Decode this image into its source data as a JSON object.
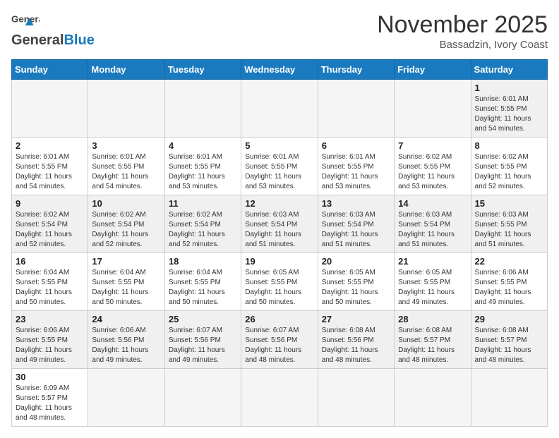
{
  "header": {
    "logo_general": "General",
    "logo_blue": "Blue",
    "month_title": "November 2025",
    "location": "Bassadzin, Ivory Coast"
  },
  "days_of_week": [
    "Sunday",
    "Monday",
    "Tuesday",
    "Wednesday",
    "Thursday",
    "Friday",
    "Saturday"
  ],
  "weeks": [
    [
      {
        "day": "",
        "info": ""
      },
      {
        "day": "",
        "info": ""
      },
      {
        "day": "",
        "info": ""
      },
      {
        "day": "",
        "info": ""
      },
      {
        "day": "",
        "info": ""
      },
      {
        "day": "",
        "info": ""
      },
      {
        "day": "1",
        "info": "Sunrise: 6:01 AM\nSunset: 5:55 PM\nDaylight: 11 hours\nand 54 minutes."
      }
    ],
    [
      {
        "day": "2",
        "info": "Sunrise: 6:01 AM\nSunset: 5:55 PM\nDaylight: 11 hours\nand 54 minutes."
      },
      {
        "day": "3",
        "info": "Sunrise: 6:01 AM\nSunset: 5:55 PM\nDaylight: 11 hours\nand 54 minutes."
      },
      {
        "day": "4",
        "info": "Sunrise: 6:01 AM\nSunset: 5:55 PM\nDaylight: 11 hours\nand 53 minutes."
      },
      {
        "day": "5",
        "info": "Sunrise: 6:01 AM\nSunset: 5:55 PM\nDaylight: 11 hours\nand 53 minutes."
      },
      {
        "day": "6",
        "info": "Sunrise: 6:01 AM\nSunset: 5:55 PM\nDaylight: 11 hours\nand 53 minutes."
      },
      {
        "day": "7",
        "info": "Sunrise: 6:02 AM\nSunset: 5:55 PM\nDaylight: 11 hours\nand 53 minutes."
      },
      {
        "day": "8",
        "info": "Sunrise: 6:02 AM\nSunset: 5:55 PM\nDaylight: 11 hours\nand 52 minutes."
      }
    ],
    [
      {
        "day": "9",
        "info": "Sunrise: 6:02 AM\nSunset: 5:54 PM\nDaylight: 11 hours\nand 52 minutes."
      },
      {
        "day": "10",
        "info": "Sunrise: 6:02 AM\nSunset: 5:54 PM\nDaylight: 11 hours\nand 52 minutes."
      },
      {
        "day": "11",
        "info": "Sunrise: 6:02 AM\nSunset: 5:54 PM\nDaylight: 11 hours\nand 52 minutes."
      },
      {
        "day": "12",
        "info": "Sunrise: 6:03 AM\nSunset: 5:54 PM\nDaylight: 11 hours\nand 51 minutes."
      },
      {
        "day": "13",
        "info": "Sunrise: 6:03 AM\nSunset: 5:54 PM\nDaylight: 11 hours\nand 51 minutes."
      },
      {
        "day": "14",
        "info": "Sunrise: 6:03 AM\nSunset: 5:54 PM\nDaylight: 11 hours\nand 51 minutes."
      },
      {
        "day": "15",
        "info": "Sunrise: 6:03 AM\nSunset: 5:55 PM\nDaylight: 11 hours\nand 51 minutes."
      }
    ],
    [
      {
        "day": "16",
        "info": "Sunrise: 6:04 AM\nSunset: 5:55 PM\nDaylight: 11 hours\nand 50 minutes."
      },
      {
        "day": "17",
        "info": "Sunrise: 6:04 AM\nSunset: 5:55 PM\nDaylight: 11 hours\nand 50 minutes."
      },
      {
        "day": "18",
        "info": "Sunrise: 6:04 AM\nSunset: 5:55 PM\nDaylight: 11 hours\nand 50 minutes."
      },
      {
        "day": "19",
        "info": "Sunrise: 6:05 AM\nSunset: 5:55 PM\nDaylight: 11 hours\nand 50 minutes."
      },
      {
        "day": "20",
        "info": "Sunrise: 6:05 AM\nSunset: 5:55 PM\nDaylight: 11 hours\nand 50 minutes."
      },
      {
        "day": "21",
        "info": "Sunrise: 6:05 AM\nSunset: 5:55 PM\nDaylight: 11 hours\nand 49 minutes."
      },
      {
        "day": "22",
        "info": "Sunrise: 6:06 AM\nSunset: 5:55 PM\nDaylight: 11 hours\nand 49 minutes."
      }
    ],
    [
      {
        "day": "23",
        "info": "Sunrise: 6:06 AM\nSunset: 5:55 PM\nDaylight: 11 hours\nand 49 minutes."
      },
      {
        "day": "24",
        "info": "Sunrise: 6:06 AM\nSunset: 5:56 PM\nDaylight: 11 hours\nand 49 minutes."
      },
      {
        "day": "25",
        "info": "Sunrise: 6:07 AM\nSunset: 5:56 PM\nDaylight: 11 hours\nand 49 minutes."
      },
      {
        "day": "26",
        "info": "Sunrise: 6:07 AM\nSunset: 5:56 PM\nDaylight: 11 hours\nand 48 minutes."
      },
      {
        "day": "27",
        "info": "Sunrise: 6:08 AM\nSunset: 5:56 PM\nDaylight: 11 hours\nand 48 minutes."
      },
      {
        "day": "28",
        "info": "Sunrise: 6:08 AM\nSunset: 5:57 PM\nDaylight: 11 hours\nand 48 minutes."
      },
      {
        "day": "29",
        "info": "Sunrise: 6:08 AM\nSunset: 5:57 PM\nDaylight: 11 hours\nand 48 minutes."
      }
    ],
    [
      {
        "day": "30",
        "info": "Sunrise: 6:09 AM\nSunset: 5:57 PM\nDaylight: 11 hours\nand 48 minutes."
      },
      {
        "day": "",
        "info": ""
      },
      {
        "day": "",
        "info": ""
      },
      {
        "day": "",
        "info": ""
      },
      {
        "day": "",
        "info": ""
      },
      {
        "day": "",
        "info": ""
      },
      {
        "day": "",
        "info": ""
      }
    ]
  ]
}
